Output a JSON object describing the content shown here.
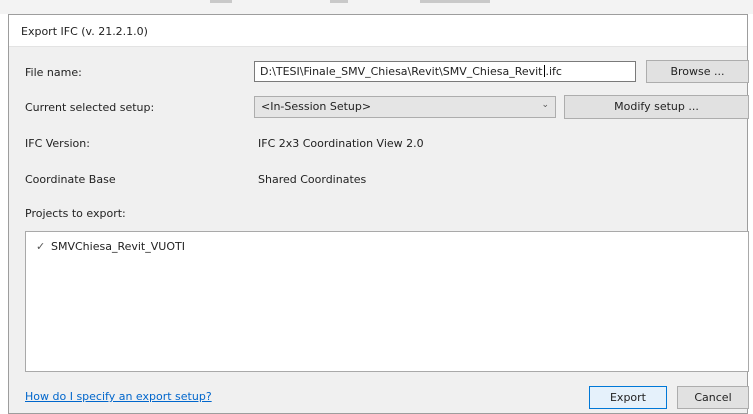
{
  "dialog": {
    "title": "Export IFC (v. 21.2.1.0)"
  },
  "form": {
    "file_name_label": "File name:",
    "file_name_value_before_caret": "D:\\TESI\\Finale_SMV_Chiesa\\Revit\\SMV_Chiesa_Revit",
    "file_name_value_after_caret": ".ifc",
    "browse_label": "Browse ...",
    "setup_label": "Current selected setup:",
    "setup_value": "<In-Session Setup>",
    "modify_setup_label": "Modify setup ...",
    "ifc_version_label": "IFC Version:",
    "ifc_version_value": "IFC 2x3 Coordination View 2.0",
    "coordinate_base_label": "Coordinate Base",
    "coordinate_base_value": "Shared Coordinates",
    "projects_label": "Projects to export:"
  },
  "projects": [
    {
      "name": "SMVChiesa_Revit_VUOTI",
      "checked": true
    }
  ],
  "footer": {
    "help_link": "How do I specify an export setup?",
    "export_label": "Export",
    "cancel_label": "Cancel"
  },
  "icons": {
    "check": "checkmark-icon",
    "dropdown": "chevron-down-icon"
  }
}
